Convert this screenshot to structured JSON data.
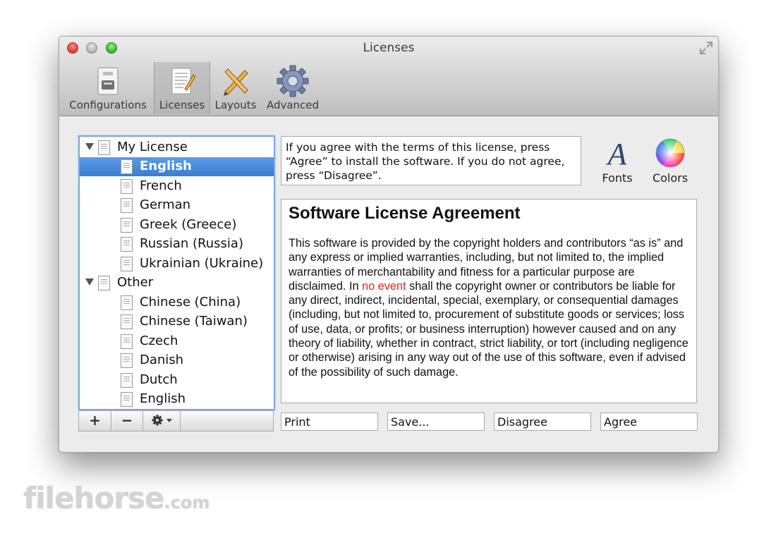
{
  "window": {
    "title": "Licenses"
  },
  "toolbar": {
    "items": [
      {
        "label": "Configurations",
        "icon": "configurations-icon"
      },
      {
        "label": "Licenses",
        "icon": "licenses-icon",
        "selected": true
      },
      {
        "label": "Layouts",
        "icon": "layouts-icon"
      },
      {
        "label": "Advanced",
        "icon": "gear-icon"
      }
    ]
  },
  "tree": {
    "groups": [
      {
        "label": "My License",
        "items": [
          "English",
          "French",
          "German",
          "Greek (Greece)",
          "Russian (Russia)",
          "Ukrainian (Ukraine)"
        ]
      },
      {
        "label": "Other",
        "items": [
          "Chinese (China)",
          "Chinese (Taiwan)",
          "Czech",
          "Danish",
          "Dutch",
          "English"
        ]
      }
    ],
    "selected": "English",
    "buttons": {
      "add": "+",
      "remove": "−"
    }
  },
  "instructions": "If you agree with the terms of this license, press “Agree” to install the software. If you do not agree, press “Disagree”.",
  "tools": {
    "fonts_label": "Fonts",
    "colors_label": "Colors",
    "fonts_glyph": "A"
  },
  "license": {
    "title": "Software License Agreement",
    "body_before": "This software is provided by the copyright holders and contributors “as is” and any express or implied warranties, including, but not limited to, the implied warranties of merchantability and fitness for a particular purpose are disclaimed. In ",
    "body_highlight": "no event",
    "body_after": " shall the copyright owner or contributors be liable for any direct, indirect, incidental, special, exemplary, or consequential damages (including, but not limited to, procurement of substitute goods or services; loss of use, data, or profits; or business interruption) however caused and on any theory of liability, whether in contract, strict liability, or tort (including negligence or otherwise) arising in any way out of the use of this software, even if advised of the possibility of such damage.",
    "highlight_color": "#e8241c"
  },
  "buttons": {
    "print": "Print",
    "save": "Save...",
    "disagree": "Disagree",
    "agree": "Agree"
  },
  "watermark": {
    "brand": "filehorse",
    "suffix": ".com"
  },
  "colors": {
    "selection": "#3a7dd0",
    "focus_ring": "#7aa7e0"
  }
}
